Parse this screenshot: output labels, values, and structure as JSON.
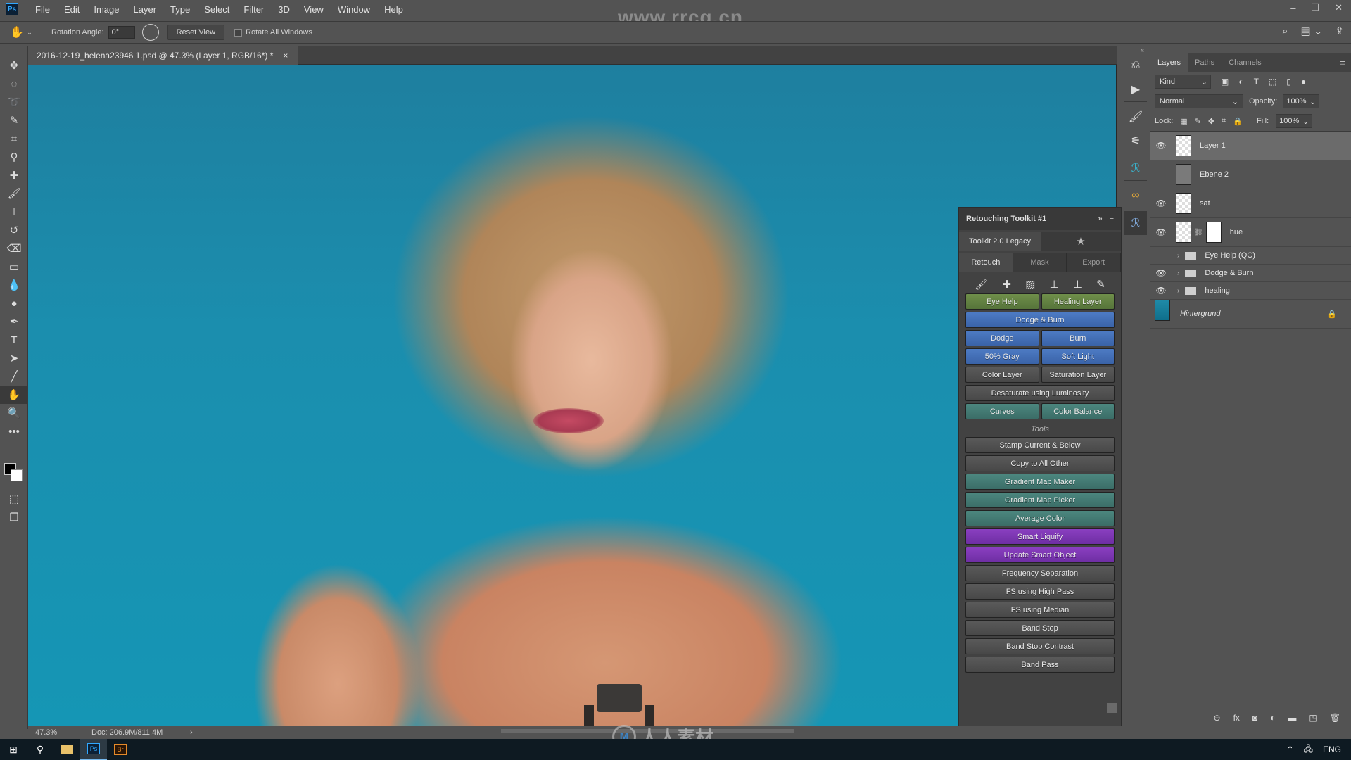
{
  "app": {
    "logo": "Ps",
    "watermark_top": "www.rrcg.cn",
    "watermark_bottom": "人人素材",
    "watermark_logo": "M"
  },
  "menu": [
    "File",
    "Edit",
    "Image",
    "Layer",
    "Type",
    "Select",
    "Filter",
    "3D",
    "View",
    "Window",
    "Help"
  ],
  "window_controls": {
    "minimize": "–",
    "restore": "❐",
    "close": "✕"
  },
  "options": {
    "tool_icon": "rotate-view-icon",
    "rotation_label": "Rotation Angle:",
    "rotation_value": "0°",
    "reset_view": "Reset View",
    "rotate_all_label": "Rotate All Windows",
    "rotate_all_checked": false
  },
  "document": {
    "tab_title": "2016-12-19_helena23946 1.psd @ 47.3% (Layer 1, RGB/16*) *",
    "close": "×",
    "zoom": "47.3%",
    "doc_info": "Doc: 206.9M/811.4M",
    "status_arrow": "›"
  },
  "tools": [
    "move",
    "marquee",
    "lasso",
    "quick-select",
    "crop",
    "eyedropper",
    "healing",
    "brush",
    "stamp",
    "history-brush",
    "eraser",
    "gradient",
    "blur",
    "dodge",
    "pen",
    "type",
    "path-select",
    "line",
    "rotate-view",
    "zoom",
    "more"
  ],
  "retouch_toolkit": {
    "title": "Retouching Toolkit #1",
    "collapse": "»",
    "menu": "≡",
    "preset": "Toolkit 2.0 Legacy",
    "favorite": "★",
    "tabs": [
      {
        "label": "Retouch",
        "selected": true
      },
      {
        "label": "Mask",
        "selected": false
      },
      {
        "label": "Export",
        "selected": false
      }
    ],
    "icon_tools": [
      "brush-icon",
      "healing-icon",
      "bandage-icon",
      "stamp-icon",
      "stamp-below-icon",
      "dropper-brush-icon"
    ],
    "retouch_rows": [
      [
        {
          "label": "Eye Help",
          "color": "green"
        },
        {
          "label": "Healing Layer",
          "color": "green"
        }
      ],
      [
        {
          "label": "Dodge & Burn",
          "color": "blue"
        }
      ],
      [
        {
          "label": "Dodge",
          "color": "blue"
        },
        {
          "label": "Burn",
          "color": "blue"
        }
      ],
      [
        {
          "label": "50% Gray",
          "color": "blue"
        },
        {
          "label": "Soft Light",
          "color": "blue"
        }
      ],
      [
        {
          "label": "Color Layer",
          "color": "gray"
        },
        {
          "label": "Saturation Layer",
          "color": "gray"
        }
      ],
      [
        {
          "label": "Desaturate using Luminosity",
          "color": "gray"
        }
      ],
      [
        {
          "label": "Curves",
          "color": "teal"
        },
        {
          "label": "Color Balance",
          "color": "teal"
        }
      ]
    ],
    "tools_heading": "Tools",
    "tools_buttons": [
      {
        "label": "Stamp Current & Below",
        "color": "gray"
      },
      {
        "label": "Copy to All Other",
        "color": "gray"
      },
      {
        "label": "Gradient Map Maker",
        "color": "teal"
      },
      {
        "label": "Gradient Map Picker",
        "color": "teal"
      },
      {
        "label": "Average Color",
        "color": "teal"
      },
      {
        "label": "Smart Liquify",
        "color": "purple"
      },
      {
        "label": "Update Smart Object",
        "color": "purple"
      },
      {
        "label": "Frequency Separation",
        "color": "gray"
      },
      {
        "label": "FS using High Pass",
        "color": "gray"
      },
      {
        "label": "FS using Median",
        "color": "gray"
      },
      {
        "label": "Band Stop",
        "color": "gray"
      },
      {
        "label": "Band Stop Contrast",
        "color": "gray"
      },
      {
        "label": "Band Pass",
        "color": "gray"
      }
    ]
  },
  "layers_panel": {
    "tabs": [
      {
        "label": "Layers",
        "selected": true
      },
      {
        "label": "Paths",
        "selected": false
      },
      {
        "label": "Channels",
        "selected": false
      }
    ],
    "filter_kind": "Kind",
    "blend_mode": "Normal",
    "opacity_label": "Opacity:",
    "opacity": "100%",
    "lock_label": "Lock:",
    "fill_label": "Fill:",
    "fill": "100%",
    "layers": [
      {
        "name": "Layer 1",
        "visible": true,
        "selected": true,
        "type": "pixel"
      },
      {
        "name": "Ebene 2",
        "visible": false,
        "selected": false,
        "type": "solid"
      },
      {
        "name": "sat",
        "visible": true,
        "selected": false,
        "type": "pixel"
      },
      {
        "name": "hue",
        "visible": true,
        "selected": false,
        "type": "masked"
      },
      {
        "name": "Eye Help (QC)",
        "visible": false,
        "selected": false,
        "type": "group"
      },
      {
        "name": "Dodge & Burn",
        "visible": true,
        "selected": false,
        "type": "group"
      },
      {
        "name": "healing",
        "visible": true,
        "selected": false,
        "type": "group"
      },
      {
        "name": "Hintergrund",
        "visible": true,
        "selected": false,
        "type": "background",
        "locked": true
      }
    ]
  },
  "taskbar": {
    "lang": "ENG",
    "ps": "Ps",
    "br": "Br"
  },
  "colors": {
    "canvas_bg": "#1596b5",
    "accent_blue": "#3a63a8",
    "accent_green": "#56743a",
    "accent_teal": "#3b6d67",
    "accent_purple": "#6e2ea3"
  }
}
